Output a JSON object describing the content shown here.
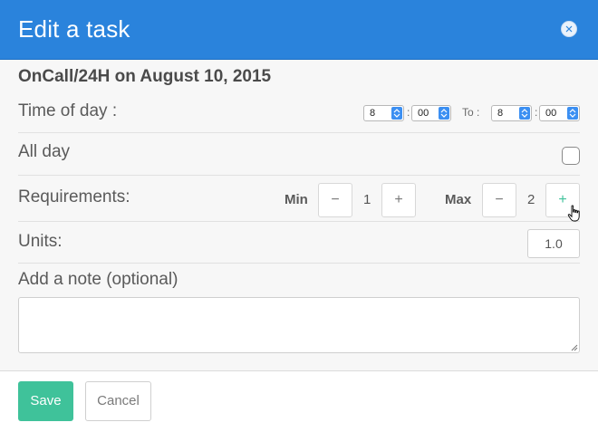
{
  "dialog": {
    "title": "Edit a task",
    "subtitle": "OnCall/24H on August 10, 2015"
  },
  "time_of_day": {
    "label": "Time of day :",
    "from_hour": "8",
    "from_minute": "00",
    "to_label": "To :",
    "to_hour": "8",
    "to_minute": "00",
    "separator": ":"
  },
  "all_day": {
    "label": "All day",
    "checked": false
  },
  "requirements": {
    "label": "Requirements:",
    "min_label": "Min",
    "min_value": "1",
    "max_label": "Max",
    "max_value": "2",
    "decrement_symbol": "−",
    "increment_symbol": "+"
  },
  "units": {
    "label": "Units:",
    "value": "1.0"
  },
  "note": {
    "label": "Add a note (optional)",
    "value": ""
  },
  "footer": {
    "save_label": "Save",
    "cancel_label": "Cancel"
  },
  "colors": {
    "header": "#2a83dc",
    "save": "#3fc29a",
    "increment_active": "#3fc29a"
  }
}
